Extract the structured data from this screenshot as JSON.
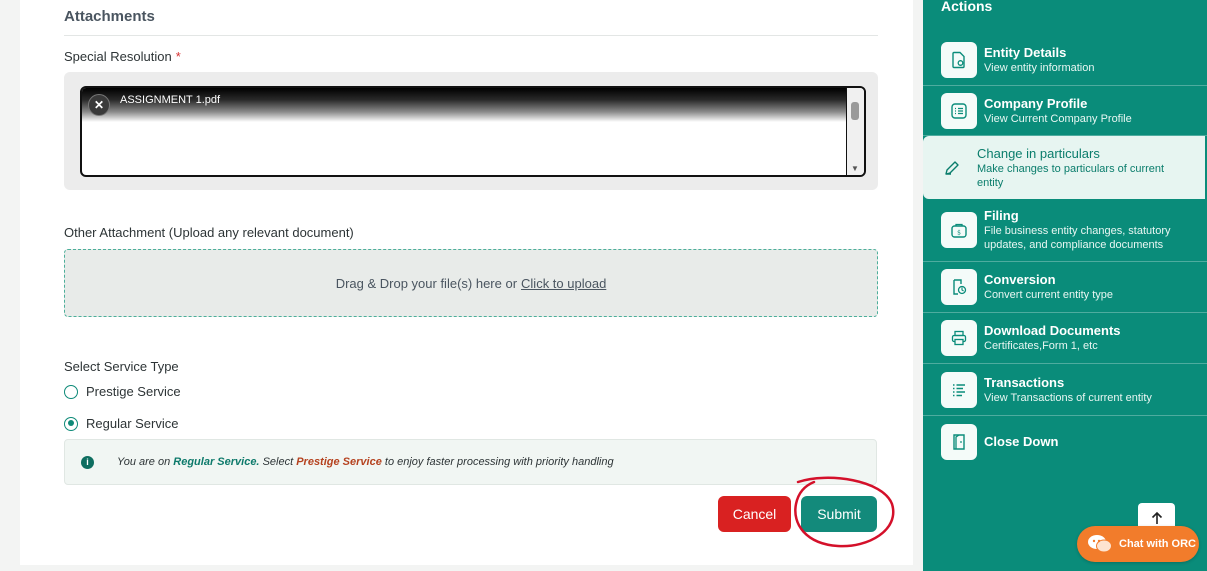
{
  "form": {
    "section_title": "Attachments",
    "special_resolution_label": "Special Resolution",
    "required_mark": "*",
    "uploaded_file": {
      "name": "ASSIGNMENT 1.pdf",
      "remove_glyph": "✕"
    },
    "other_attachment_label": "Other Attachment (Upload any relevant document)",
    "dropzone": {
      "text": "Drag & Drop your file(s) here or",
      "link": "Click to upload"
    },
    "service_type_label": "Select Service Type",
    "service_options": [
      {
        "label": "Prestige Service",
        "selected": false
      },
      {
        "label": "Regular Service",
        "selected": true
      }
    ],
    "info": {
      "icon_glyph": "i",
      "prefix": "You are on",
      "current": "Regular Service.",
      "middle": "Select",
      "alternative": "Prestige Service",
      "suffix": "to enjoy faster processing with priority handling"
    },
    "cancel_label": "Cancel",
    "submit_label": "Submit"
  },
  "actions": {
    "title": "Actions",
    "items": [
      {
        "title": "Entity Details",
        "subtitle": "View entity information",
        "icon": "document-eye-icon",
        "active": false
      },
      {
        "title": "Company Profile",
        "subtitle": "View Current Company Profile",
        "icon": "profile-list-icon",
        "active": false
      },
      {
        "title": "Change in particulars",
        "subtitle": "Make changes to particulars of current entity",
        "icon": "pencil-icon",
        "active": true
      },
      {
        "title": "Filing",
        "subtitle": "File business entity changes, statutory updates, and compliance documents",
        "icon": "filing-bag-icon",
        "active": false
      },
      {
        "title": "Conversion",
        "subtitle": "Convert current entity type",
        "icon": "conversion-icon",
        "active": false
      },
      {
        "title": "Download Documents",
        "subtitle": "Certificates,Form 1, etc",
        "icon": "printer-icon",
        "active": false
      },
      {
        "title": "Transactions",
        "subtitle": "View Transactions of current entity",
        "icon": "transactions-list-icon",
        "active": false
      },
      {
        "title": "Close Down",
        "subtitle": "",
        "icon": "door-close-icon",
        "active": false
      }
    ]
  },
  "chat": {
    "label": "Chat with ORC",
    "icon": "chat-bubbles-icon"
  },
  "scroll_top": {
    "icon": "arrow-up-icon"
  },
  "colors": {
    "accent": "#0a8c7a",
    "submit": "#138a7b",
    "cancel": "#d92121",
    "chat": "#f27c2b",
    "annotation": "#d4102a"
  }
}
